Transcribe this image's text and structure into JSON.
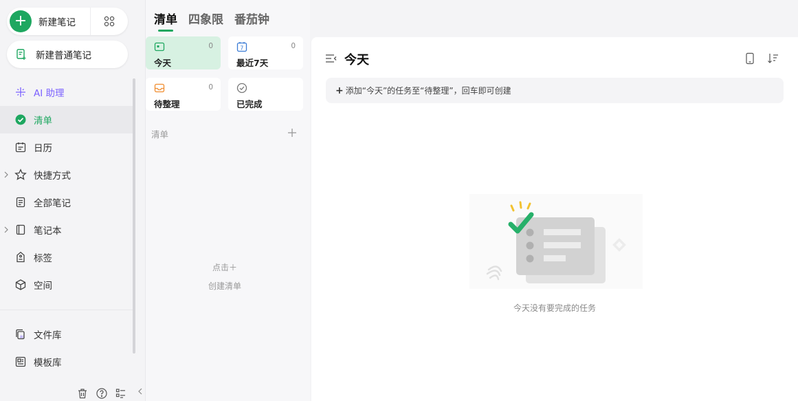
{
  "sidebar": {
    "new_note_label": "新建笔记",
    "new_plain_note_label": "新建普通笔记",
    "items": [
      {
        "label": "AI 助理",
        "icon": "sparkle-icon"
      },
      {
        "label": "清单",
        "icon": "check-circle-icon",
        "active": true
      },
      {
        "label": "日历",
        "icon": "calendar-icon"
      },
      {
        "label": "快捷方式",
        "icon": "star-icon",
        "expandable": true
      },
      {
        "label": "全部笔记",
        "icon": "notes-icon"
      },
      {
        "label": "笔记本",
        "icon": "notebook-icon",
        "expandable": true
      },
      {
        "label": "标签",
        "icon": "tag-icon"
      },
      {
        "label": "空间",
        "icon": "cube-icon"
      }
    ],
    "bottom_items": [
      {
        "label": "文件库",
        "icon": "ai-file-icon"
      },
      {
        "label": "模板库",
        "icon": "template-icon"
      }
    ]
  },
  "tabs": [
    {
      "label": "清单",
      "active": true
    },
    {
      "label": "四象限"
    },
    {
      "label": "番茄钟"
    }
  ],
  "smart_lists": [
    {
      "title": "今天",
      "count": "0",
      "icon": "today-icon",
      "active": true
    },
    {
      "title": "最近7天",
      "count": "0",
      "icon": "week-icon"
    },
    {
      "title": "待整理",
      "count": "0",
      "icon": "inbox-icon"
    },
    {
      "title": "已完成",
      "count": "",
      "icon": "done-icon"
    }
  ],
  "list_section": {
    "label": "清单",
    "empty_line1": "点击＋",
    "empty_line2": "创建清单"
  },
  "main": {
    "title": "今天",
    "add_task_placeholder": "添加“今天”的任务至“待整理”，回车即可创建",
    "empty_message": "今天没有要完成的任务"
  },
  "colors": {
    "accent": "#1ea760",
    "ai": "#7b61ff",
    "active_card": "#d7f1e2"
  }
}
